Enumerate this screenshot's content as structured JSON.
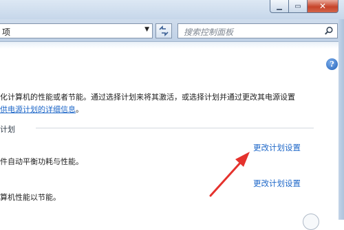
{
  "address": {
    "text": "项"
  },
  "search": {
    "placeholder": "搜索控制面板"
  },
  "help": {
    "label": "?"
  },
  "intro": {
    "line1": "化计算机的性能或者节能。通过选择计划来将其激活，或选择计划并通过更改其电源设置",
    "line2_link": "供电源计划的详细信息",
    "line2_end": "。"
  },
  "section": {
    "title": "计划"
  },
  "plans": [
    {
      "desc": "件自动平衡功耗与性能。",
      "change_link": "更改计划设置"
    },
    {
      "desc": "算机性能以节能。",
      "change_link": "更改计划设置"
    }
  ],
  "colors": {
    "link": "#1e67c8",
    "arrow": "#e5322d"
  },
  "icons": [
    "minimize-icon",
    "maximize-icon",
    "close-icon",
    "dropdown-icon",
    "refresh-icon",
    "search-icon",
    "help-icon",
    "annotation-arrow"
  ]
}
